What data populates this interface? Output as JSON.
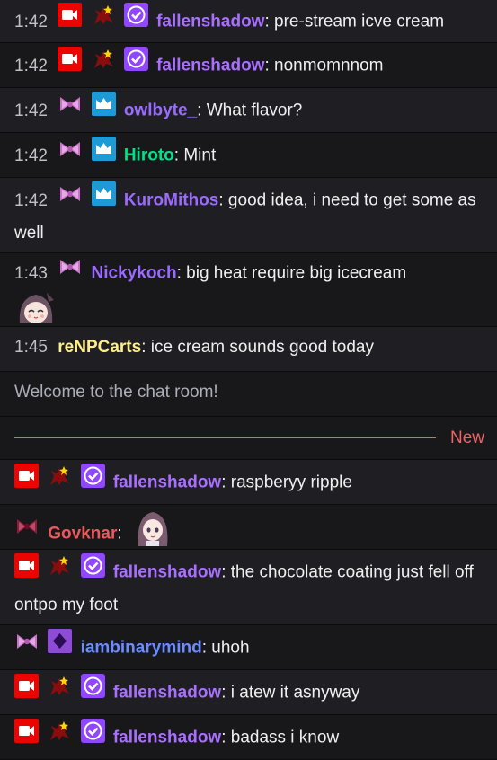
{
  "messages": [
    {
      "time": "1:42",
      "user": "fallenshadow",
      "color": "#a970ff",
      "text": ": pre-stream icve cream"
    },
    {
      "time": "1:42",
      "user": "fallenshadow",
      "color": "#a970ff",
      "text": ": nonmomnnom"
    },
    {
      "time": "1:42",
      "user": "owlbyte_",
      "color": "#9147ff",
      "text": ": What flavor?"
    },
    {
      "time": "1:42",
      "user": "Hiroto",
      "color": "#00e28a",
      "text": ": Mint"
    },
    {
      "time": "1:42",
      "user": "KuroMithos",
      "color": "#9b6bff",
      "text": ": good idea, i need to get some as well"
    },
    {
      "time": "1:43",
      "user": "Nickykoch",
      "color": "#9b6bff",
      "text": ": big heat require big icecream"
    },
    {
      "time": "1:45",
      "user": "reNPCarts",
      "color": "#ffee8a",
      "text": ": ice cream sounds good today"
    }
  ],
  "system_message": "Welcome to the chat room!",
  "divider_label": "New",
  "new_messages": [
    {
      "user": "fallenshadow",
      "text": ": raspberyy ripple"
    },
    {
      "user": "Govknar",
      "text": ":"
    },
    {
      "user": "fallenshadow",
      "text": ": the chocolate coating just fell off ontpo my foot"
    },
    {
      "user": "iambinarymind",
      "text": ": uhoh"
    },
    {
      "user": "fallenshadow",
      "text": ": i atew it asnyway"
    },
    {
      "user": "fallenshadow",
      "text": ": badass i know"
    }
  ],
  "colors": {
    "fallenshadow": "#a970ff",
    "purple": "#9b6bff",
    "green": "#00e28a",
    "yellow": "#ffee8a",
    "red": "#eb5a5a",
    "blue": "#6b8cff",
    "divider": "#eb6565"
  },
  "icons": [
    "camera-icon",
    "dragon-icon",
    "verified-icon",
    "bow-icon",
    "crown-icon",
    "diamond-icon",
    "anime-emote"
  ]
}
